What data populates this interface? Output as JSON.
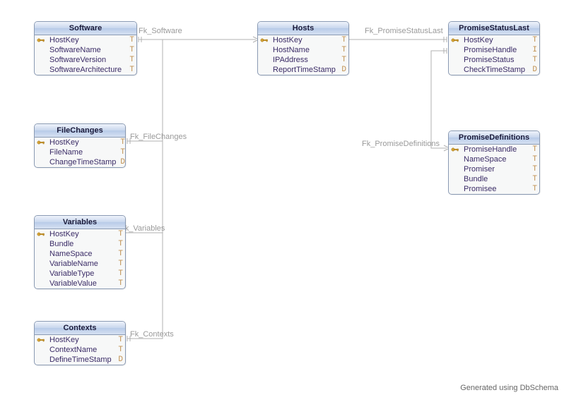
{
  "footer": "Generated using DbSchema",
  "tables": {
    "software": {
      "title": "Software",
      "cols": [
        {
          "icon": "pk",
          "name": "HostKey",
          "type": "T"
        },
        {
          "icon": "",
          "name": "SoftwareName",
          "type": "T"
        },
        {
          "icon": "",
          "name": "SoftwareVersion",
          "type": "T"
        },
        {
          "icon": "",
          "name": "SoftwareArchitecture",
          "type": "T"
        }
      ]
    },
    "hosts": {
      "title": "Hosts",
      "cols": [
        {
          "icon": "pk",
          "name": "HostKey",
          "type": "T"
        },
        {
          "icon": "",
          "name": "HostName",
          "type": "T"
        },
        {
          "icon": "",
          "name": "IPAddress",
          "type": "T"
        },
        {
          "icon": "",
          "name": "ReportTimeStamp",
          "type": "D"
        }
      ]
    },
    "promiseStatusLast": {
      "title": "PromiseStatusLast",
      "cols": [
        {
          "icon": "pk",
          "name": "HostKey",
          "type": "T"
        },
        {
          "icon": "",
          "name": "PromiseHandle",
          "type": "I"
        },
        {
          "icon": "",
          "name": "PromiseStatus",
          "type": "T"
        },
        {
          "icon": "",
          "name": "CheckTimeStamp",
          "type": "D"
        }
      ]
    },
    "fileChanges": {
      "title": "FileChanges",
      "cols": [
        {
          "icon": "pk",
          "name": "HostKey",
          "type": "T"
        },
        {
          "icon": "",
          "name": "FileName",
          "type": "T"
        },
        {
          "icon": "",
          "name": "ChangeTimeStamp",
          "type": "D"
        }
      ]
    },
    "promiseDefinitions": {
      "title": "PromiseDefinitions",
      "cols": [
        {
          "icon": "pk",
          "name": "PromiseHandle",
          "type": "T"
        },
        {
          "icon": "",
          "name": "NameSpace",
          "type": "T"
        },
        {
          "icon": "",
          "name": "Promiser",
          "type": "T"
        },
        {
          "icon": "",
          "name": "Bundle",
          "type": "T"
        },
        {
          "icon": "",
          "name": "Promisee",
          "type": "T"
        }
      ]
    },
    "variables": {
      "title": "Variables",
      "cols": [
        {
          "icon": "pk",
          "name": "HostKey",
          "type": "T"
        },
        {
          "icon": "",
          "name": "Bundle",
          "type": "T"
        },
        {
          "icon": "",
          "name": "NameSpace",
          "type": "T"
        },
        {
          "icon": "",
          "name": "VariableName",
          "type": "T"
        },
        {
          "icon": "",
          "name": "VariableType",
          "type": "T"
        },
        {
          "icon": "",
          "name": "VariableValue",
          "type": "T"
        }
      ]
    },
    "contexts": {
      "title": "Contexts",
      "cols": [
        {
          "icon": "pk",
          "name": "HostKey",
          "type": "T"
        },
        {
          "icon": "",
          "name": "ContextName",
          "type": "T"
        },
        {
          "icon": "",
          "name": "DefineTimeStamp",
          "type": "D"
        }
      ]
    }
  },
  "relations": {
    "fk_software": "Fk_Software",
    "fk_filechanges": "Fk_FileChanges",
    "fk_variables": "Fk_Variables",
    "fk_contexts": "Fk_Contexts",
    "fk_promisestatuslast": "Fk_PromiseStatusLast",
    "fk_promisedefinitions": "Fk_PromiseDefinitions"
  }
}
